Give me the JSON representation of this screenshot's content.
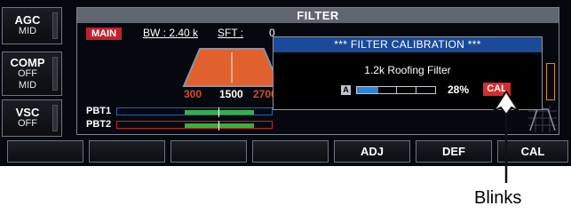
{
  "side_keys": [
    {
      "title": "AGC",
      "values": [
        "MID"
      ]
    },
    {
      "title": "COMP",
      "values": [
        "OFF",
        "MID"
      ]
    },
    {
      "title": "VSC",
      "values": [
        "OFF"
      ]
    }
  ],
  "filter_screen": {
    "title": "FILTER",
    "main_badge": "MAIN",
    "bw_label": "BW : 2.40 k",
    "sft_label": "SFT :",
    "sft_value": "0",
    "axis": {
      "low": "300",
      "center": "1500",
      "high": "2700"
    },
    "pbt": [
      "PBT1",
      "PBT2"
    ]
  },
  "dialog": {
    "title": "*** FILTER CALIBRATION ***",
    "subtitle": "1.2k Roofing Filter",
    "mode_badge": "A",
    "progress_fraction": 0.28,
    "percent_text": "28%",
    "cal_badge": "CAL"
  },
  "softkeys": [
    "",
    "",
    "",
    "",
    "ADJ",
    "DEF",
    "CAL"
  ],
  "annotation": {
    "text": "Blinks"
  },
  "colors": {
    "filter_fill": "#e0612e",
    "filter_outline": "#8a93a8",
    "axis_text": "#d94a2a",
    "pbt1_outline": "#2a5fc0",
    "pbt2_outline": "#c02a2a",
    "progress_fill": "#2b86d6",
    "dialog_title_bg": "#1a4a98"
  }
}
